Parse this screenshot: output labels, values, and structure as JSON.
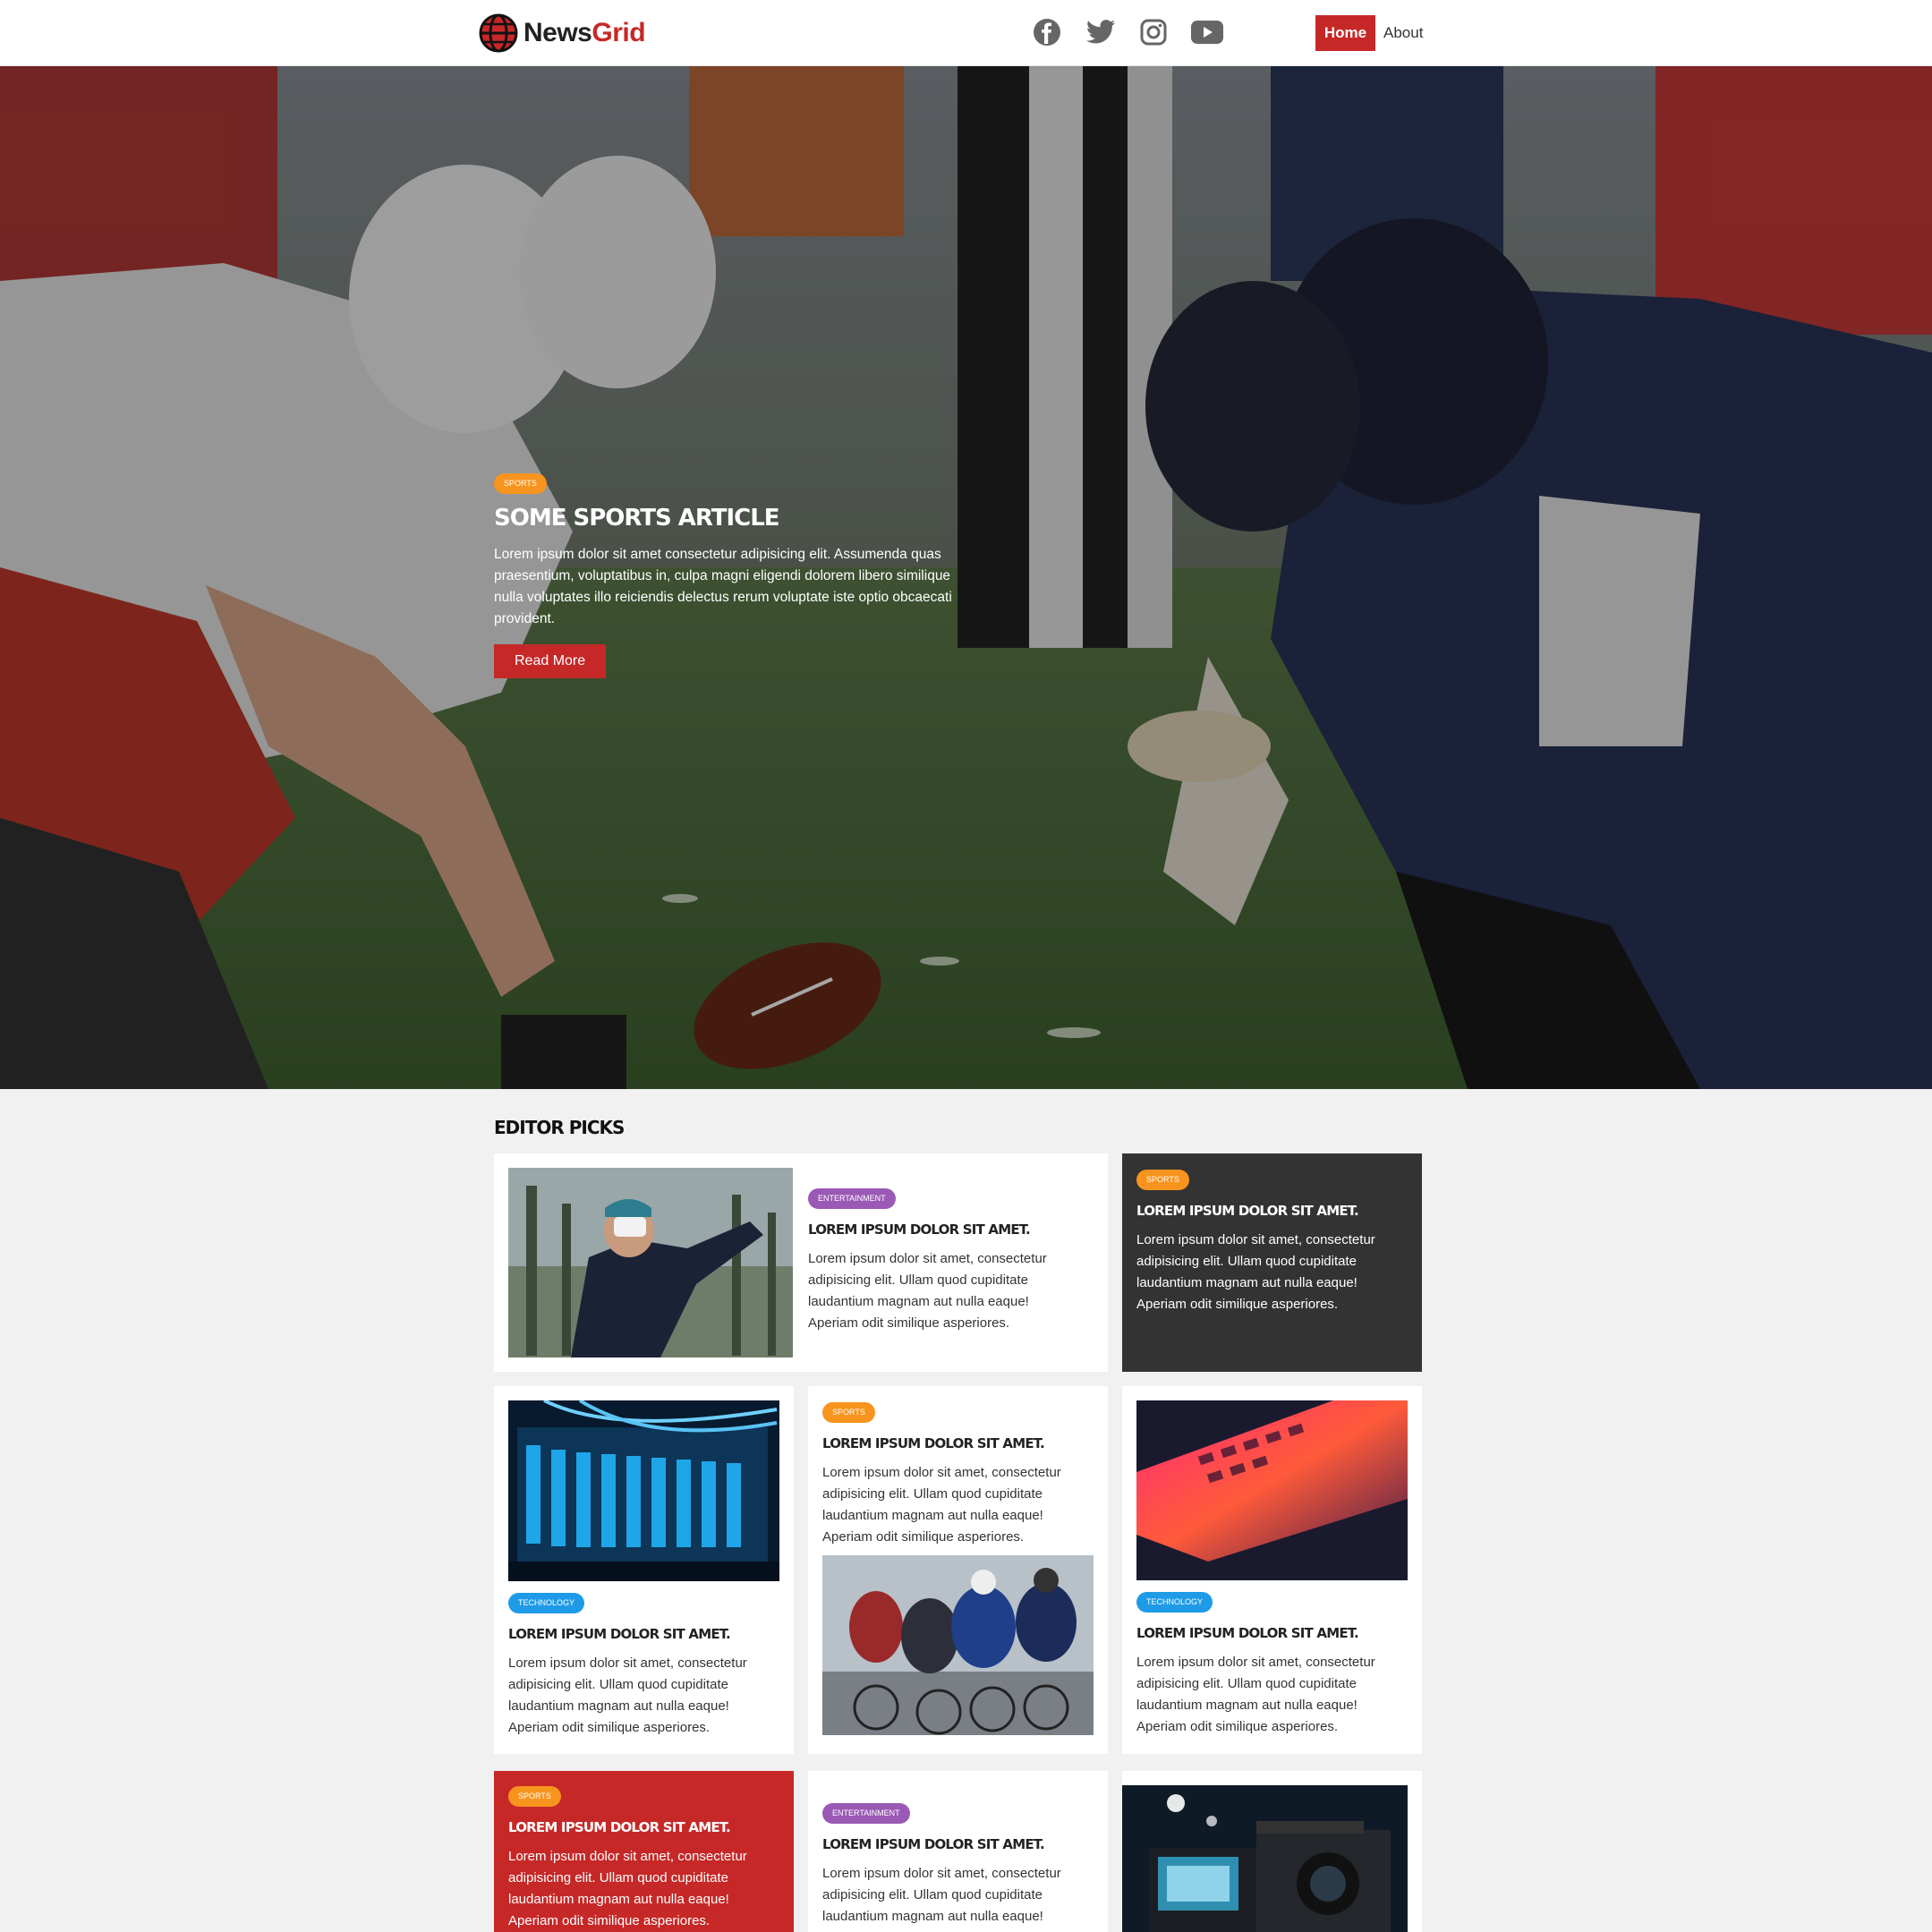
{
  "brand": {
    "part1": "News",
    "part2": "Grid"
  },
  "social": [
    "facebook-icon",
    "twitter-icon",
    "instagram-icon",
    "youtube-icon"
  ],
  "nav": {
    "home": "Home",
    "about": "About"
  },
  "hero": {
    "category": "Sports",
    "title": "Some Sports Article",
    "text": "Lorem ipsum dolor sit amet consectetur adipisicing elit. Assumenda quas praesentium, voluptatibus in, culpa magni eligendi dolorem libero similique nulla voluptates illo reiciendis delectus rerum voluptate iste optio obcaecati provident.",
    "button": "Read More"
  },
  "section_title": "Editor Picks",
  "cards": [
    {
      "category": "Entertainment",
      "title": "Lorem ipsum dolor sit amet.",
      "text": "Lorem ipsum dolor sit amet, consectetur adipisicing elit. Ullam quod cupiditate laudantium magnam aut nulla eaque! Aperiam odit similique asperiores."
    },
    {
      "category": "Sports",
      "title": "Lorem ipsum dolor sit amet.",
      "text": "Lorem ipsum dolor sit amet, consectetur adipisicing elit. Ullam quod cupiditate laudantium magnam aut nulla eaque! Aperiam odit similique asperiores."
    },
    {
      "category": "Technology",
      "title": "Lorem ipsum dolor sit amet.",
      "text": "Lorem ipsum dolor sit amet, consectetur adipisicing elit. Ullam quod cupiditate laudantium magnam aut nulla eaque! Aperiam odit similique asperiores."
    },
    {
      "category": "Sports",
      "title": "Lorem ipsum dolor sit amet.",
      "text": "Lorem ipsum dolor sit amet, consectetur adipisicing elit. Ullam quod cupiditate laudantium magnam aut nulla eaque! Aperiam odit similique asperiores."
    },
    {
      "category": "Technology",
      "title": "Lorem ipsum dolor sit amet.",
      "text": "Lorem ipsum dolor sit amet, consectetur adipisicing elit. Ullam quod cupiditate laudantium magnam aut nulla eaque! Aperiam odit similique asperiores."
    },
    {
      "category": "Sports",
      "title": "Lorem ipsum dolor sit amet.",
      "text": "Lorem ipsum dolor sit amet, consectetur adipisicing elit. Ullam quod cupiditate laudantium magnam aut nulla eaque! Aperiam odit similique asperiores."
    },
    {
      "category": "Entertainment",
      "title": "Lorem ipsum dolor sit amet.",
      "text": "Lorem ipsum dolor sit amet, consectetur adipisicing elit. Ullam quod cupiditate laudantium magnam aut nulla eaque!"
    }
  ],
  "colors": {
    "brand_red": "#c62828",
    "sports": "#f7941d",
    "entertainment": "#9b59b6",
    "technology": "#1e9be6",
    "dark_card": "#333333"
  }
}
